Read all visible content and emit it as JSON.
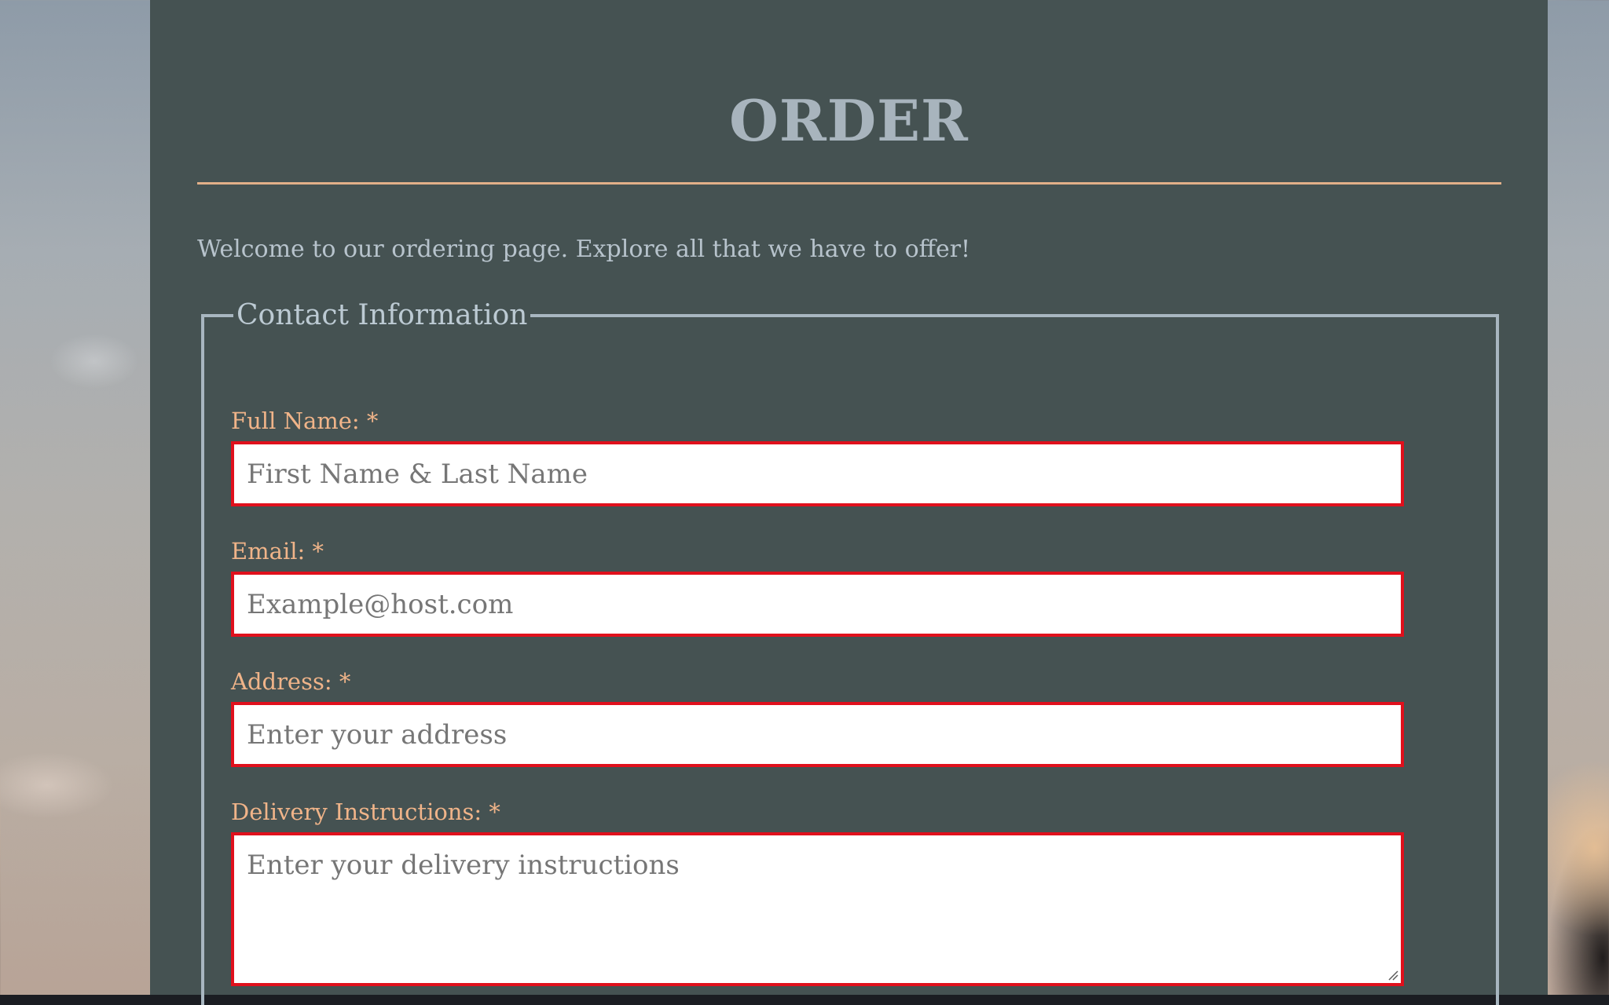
{
  "page": {
    "title": "ORDER",
    "welcome_text": "Welcome to our ordering page. Explore all that we have to offer!"
  },
  "contact": {
    "legend": "Contact Information",
    "full_name": {
      "label": "Full Name: *",
      "placeholder": "First Name & Last Name"
    },
    "email": {
      "label": "Email: *",
      "placeholder": "Example@host.com"
    },
    "address": {
      "label": "Address: *",
      "placeholder": "Enter your address"
    },
    "delivery": {
      "label": "Delivery Instructions: *",
      "placeholder": "Enter your delivery instructions"
    }
  },
  "colors": {
    "panel": "#455252",
    "title": "#a8b4bd",
    "accent_rule": "#e2b089",
    "label": "#f0b489",
    "input_border": "#e0101c"
  }
}
